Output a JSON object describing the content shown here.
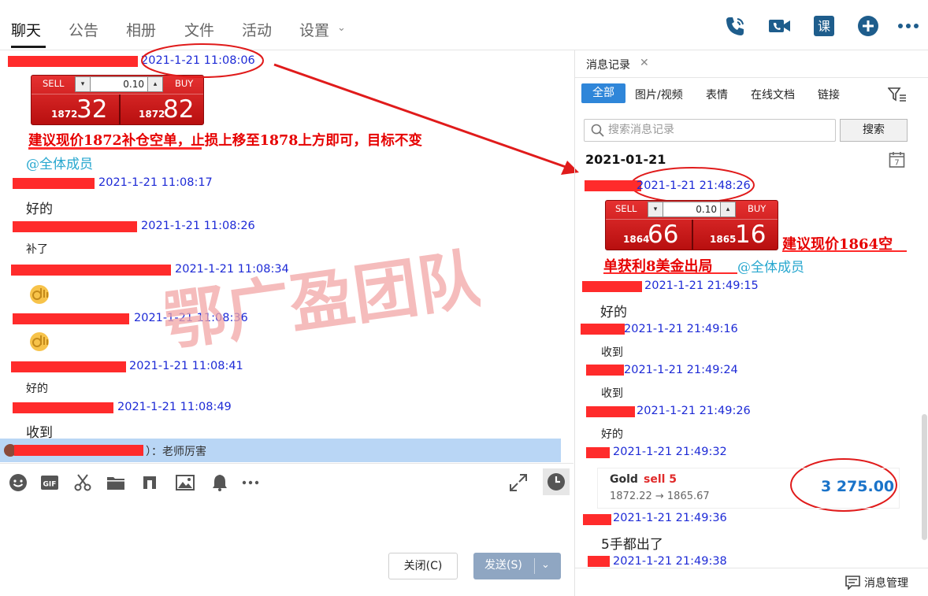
{
  "nav": {
    "tabs": [
      "聊天",
      "公告",
      "相册",
      "文件",
      "活动",
      "设置"
    ],
    "active": "聊天"
  },
  "watermark": "鄂广盈团队",
  "colors": {
    "accent": "#2f86d9",
    "redact": "#ff2b2b",
    "timestamp": "#1d2ad6",
    "annotation": "#e60000",
    "mention": "#27a7cf"
  },
  "chat": {
    "messages": [
      {
        "time": "2021-1-21 11:08:06"
      },
      {
        "time": "2021-1-21 11:08:17",
        "text": "好的"
      },
      {
        "time": "2021-1-21 11:08:26",
        "text": "补了"
      },
      {
        "time": "2021-1-21 11:08:34"
      },
      {
        "time": "2021-1-21 11:08:36"
      },
      {
        "time": "2021-1-21 11:08:41",
        "text": "好的"
      },
      {
        "time": "2021-1-21 11:08:49",
        "text": "收到"
      }
    ],
    "note": "建议现价1872补仓空单，止损上移至1878上方即可，目标不变",
    "at_all": "@全体成员",
    "trade": {
      "sell_label": "SELL",
      "buy_label": "BUY",
      "lot": "0.10",
      "sell_small": "1872",
      "sell_big": "32",
      "buy_small": "1872",
      "buy_big": "82"
    },
    "mention_text": "）：老师厉害"
  },
  "composer": {
    "close_label": "关闭(C)",
    "send_label": "发送(S)"
  },
  "history": {
    "tab_title": "消息记录",
    "filters": [
      "全部",
      "图片/视频",
      "表情",
      "在线文档",
      "链接"
    ],
    "search_placeholder": "搜索消息记录",
    "search_button": "搜索",
    "date": "2021-01-21",
    "calendar_day": "7",
    "messages": [
      {
        "time": "2021-1-21 21:48:26"
      },
      {
        "time": "2021-1-21 21:49:15",
        "text": "好的"
      },
      {
        "time": "2021-1-21 21:49:16",
        "text": "收到"
      },
      {
        "time": "2021-1-21 21:49:24",
        "text": "收到"
      },
      {
        "time": "2021-1-21 21:49:26",
        "text": "好的"
      },
      {
        "time": "2021-1-21 21:49:32"
      },
      {
        "time": "2021-1-21 21:49:36",
        "text": "5手都出了"
      },
      {
        "time": "2021-1-21 21:49:38"
      }
    ],
    "trade": {
      "sell_label": "SELL",
      "buy_label": "BUY",
      "lot": "0.10",
      "sell_small": "1864",
      "sell_big": "66",
      "buy_small": "1865",
      "buy_big": "16"
    },
    "note_line1": "建议现价1864空",
    "note_line2": "单获利8美金出局",
    "at_all": "@全体成员",
    "order": {
      "symbol": "Gold",
      "side": "sell 5",
      "prices": "1872.22 → 1865.67",
      "profit": "3 275.00"
    },
    "manage_label": "消息管理"
  }
}
